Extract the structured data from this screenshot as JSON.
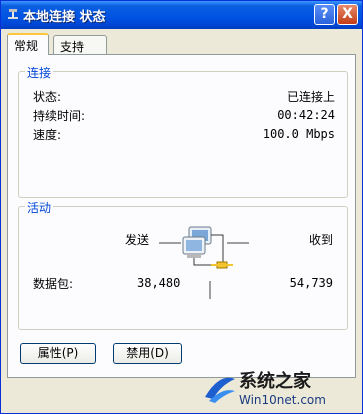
{
  "window": {
    "title": "本地连接 状态",
    "help_glyph": "?",
    "close_glyph": "X"
  },
  "tabs": [
    {
      "label": "常规",
      "active": true
    },
    {
      "label": "支持",
      "active": false
    }
  ],
  "connection": {
    "title": "连接",
    "rows": [
      {
        "label": "状态:",
        "value": "已连接上"
      },
      {
        "label": "持续时间:",
        "value": "00:42:24"
      },
      {
        "label": "速度:",
        "value": "100.0 Mbps"
      }
    ]
  },
  "activity": {
    "title": "活动",
    "sent_label": "发送",
    "received_label": "收到",
    "packets_label": "数据包:",
    "packets_sent": "38,480",
    "packets_received": "54,739",
    "icon": "network-activity-icon"
  },
  "buttons": {
    "properties": "属性(P)",
    "disable": "禁用(D)"
  },
  "watermark": {
    "line1": "系统之家",
    "line2": "Win10net.com"
  },
  "colors": {
    "titlebar": "#0054e3",
    "group_title": "#0046d5",
    "tab_highlight": "#ffc83c"
  }
}
